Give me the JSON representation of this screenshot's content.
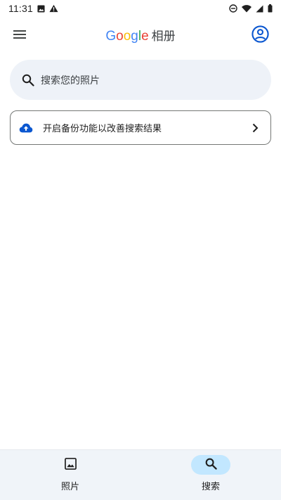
{
  "status_bar": {
    "time": "11:31",
    "icons_left": [
      "photo-notification-icon",
      "warning-icon"
    ],
    "icons_right": [
      "do-not-disturb-icon",
      "wifi-icon",
      "signal-icon",
      "battery-icon"
    ]
  },
  "app_bar": {
    "brand": [
      "G",
      "o",
      "o",
      "g",
      "l",
      "e"
    ],
    "product": "相册",
    "menu_icon": "hamburger-menu-icon",
    "account_icon": "account-circle-icon"
  },
  "search": {
    "placeholder": "搜索您的照片",
    "icon": "search-icon"
  },
  "backup_card": {
    "text": "开启备份功能以改善搜索结果",
    "icon": "cloud-upload-icon",
    "chevron": "chevron-right-icon"
  },
  "bottom_nav": {
    "items": [
      {
        "label": "照片",
        "icon": "photo-icon",
        "active": false
      },
      {
        "label": "搜索",
        "icon": "search-icon",
        "active": true
      }
    ]
  },
  "colors": {
    "accent": "#0b57d0",
    "search_bg": "#eef2f8",
    "nav_bg": "#f0f4f9",
    "active_pill": "#c2e7ff",
    "google_blue": "#4285f4",
    "google_red": "#ea4335",
    "google_yellow": "#fbbc05",
    "google_green": "#34a853"
  }
}
